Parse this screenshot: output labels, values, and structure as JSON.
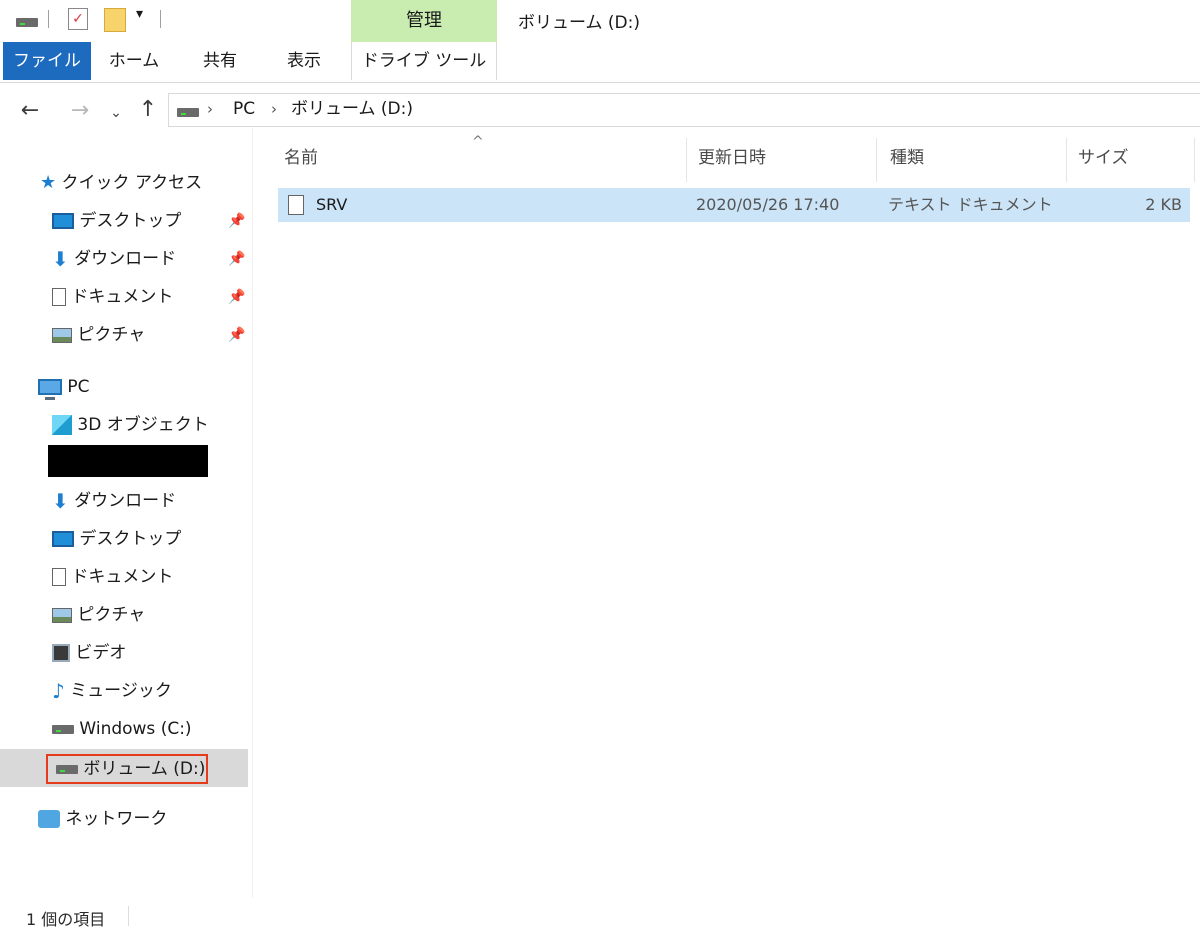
{
  "title_bar": {
    "context_group": "管理",
    "window_title": "ボリューム (D:)"
  },
  "ribbon": {
    "tabs": [
      "ファイル",
      "ホーム",
      "共有",
      "表示",
      "ドライブ ツール"
    ]
  },
  "address_bar": {
    "breadcrumbs": [
      "PC",
      "ボリューム (D:)"
    ]
  },
  "nav_pane": {
    "quick_access": {
      "label": "クイック アクセス",
      "items": [
        "デスクトップ",
        "ダウンロード",
        "ドキュメント",
        "ピクチャ"
      ]
    },
    "pc": {
      "label": "PC",
      "items": [
        "3D オブジェクト",
        "ダウンロード",
        "デスクトップ",
        "ドキュメント",
        "ピクチャ",
        "ビデオ",
        "ミュージック",
        "Windows (C:)",
        "ボリューム (D:)"
      ]
    },
    "network": "ネットワーク"
  },
  "file_list": {
    "columns": [
      "名前",
      "更新日時",
      "種類",
      "サイズ"
    ],
    "rows": [
      {
        "name": "SRV",
        "modified": "2020/05/26 17:40",
        "type": "テキスト ドキュメント",
        "size": "2 KB"
      }
    ]
  },
  "status_bar": {
    "item_count": "1 個の項目"
  },
  "icons": {
    "highlight_color": "#e53b1c",
    "file_tab_color": "#1c6bbf",
    "context_tab_color": "#c9ecb0",
    "selected_row_color": "#cce4f7"
  }
}
